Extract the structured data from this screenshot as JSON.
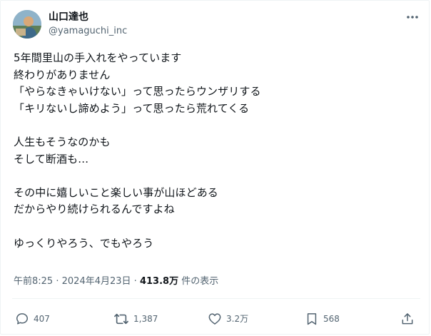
{
  "author": {
    "display_name": "山口達也",
    "handle": "@yamaguchi_inc"
  },
  "tweet": {
    "lines": [
      "5年間里山の手入れをやっています",
      "終わりがありません",
      "「やらなきゃいけない」って思ったらウンザリする",
      "「キリないし諦めよう」って思ったら荒れてくる",
      "",
      "人生もそうなのかも",
      "そして断酒も…",
      "",
      "その中に嬉しいこと楽しい事が山ほどある",
      "だからやり続けられるんですよね",
      "",
      "ゆっくりやろう、でもやろう"
    ]
  },
  "meta": {
    "time": "午前8:25",
    "separator": "·",
    "date": "2024年4月23日",
    "views_count": "413.8万",
    "views_label": "件の表示"
  },
  "actions": {
    "replies": "407",
    "retweets": "1,387",
    "likes": "3.2万",
    "bookmarks": "568"
  },
  "icons": {
    "more": "more-horizontal-icon",
    "reply": "reply-icon",
    "retweet": "retweet-icon",
    "like": "heart-icon",
    "bookmark": "bookmark-icon",
    "share": "share-icon"
  },
  "colors": {
    "text": "#0f1419",
    "secondary": "#536471",
    "border": "#eff3f4"
  }
}
